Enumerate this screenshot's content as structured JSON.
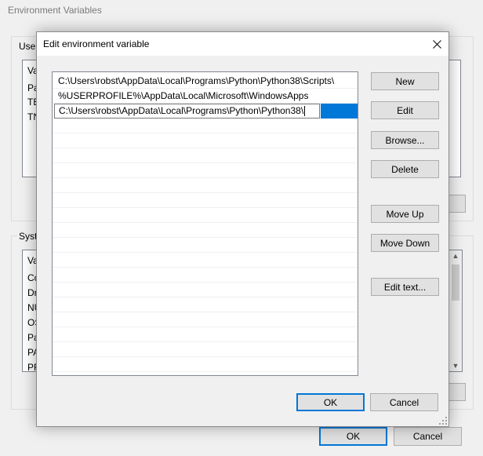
{
  "parent": {
    "title": "Environment Variables",
    "user_group_label": "User",
    "user_list_items": [
      "Va",
      "Pa",
      "TE",
      "TN"
    ],
    "system_group_label": "Syste",
    "system_list_items": [
      "Va",
      "Co",
      "Dr",
      "NU",
      "OS",
      "Pa",
      "PA",
      "PR"
    ],
    "ok_label": "OK",
    "cancel_label": "Cancel"
  },
  "dialog": {
    "title": "Edit environment variable",
    "paths": [
      "C:\\Users\\robst\\AppData\\Local\\Programs\\Python\\Python38\\Scripts\\",
      "%USERPROFILE%\\AppData\\Local\\Microsoft\\WindowsApps"
    ],
    "editing_value": "C:\\Users\\robst\\AppData\\Local\\Programs\\Python\\Python38\\",
    "buttons": {
      "new": "New",
      "edit": "Edit",
      "browse": "Browse...",
      "delete": "Delete",
      "move_up": "Move Up",
      "move_down": "Move Down",
      "edit_text": "Edit text...",
      "ok": "OK",
      "cancel": "Cancel"
    }
  },
  "colors": {
    "accent": "#0078d7",
    "button_face": "#e1e1e1",
    "window_bg": "#f0f0f0"
  }
}
